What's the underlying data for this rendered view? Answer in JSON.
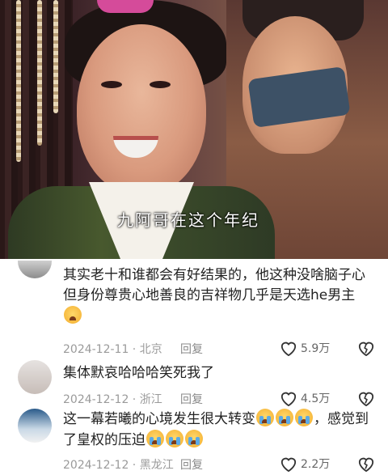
{
  "video": {
    "subtitle": "九阿哥在这个年纪"
  },
  "comments": [
    {
      "avatar_icon": "user-avatar",
      "text": "其实老十和谁都会有好结果的，他这种没啥脑子心但身份尊贵心地善良的吉祥物几乎是天选he男主",
      "date": "2024-12-11 · 北京",
      "reply": "回复",
      "likes": "5.9万"
    },
    {
      "avatar_icon": "user-avatar",
      "text": "集体默哀哈哈哈笑死我了",
      "date": "2024-12-12 · 浙江",
      "reply": "回复",
      "likes": "4.5万"
    },
    {
      "avatar_icon": "user-avatar",
      "text_a": "这一幕若曦的心境发生很大转变",
      "text_b": "，感觉到了皇权的压迫",
      "date": "2024-12-12 · 黑龙江",
      "reply": "回复",
      "likes": "2.2万"
    }
  ]
}
